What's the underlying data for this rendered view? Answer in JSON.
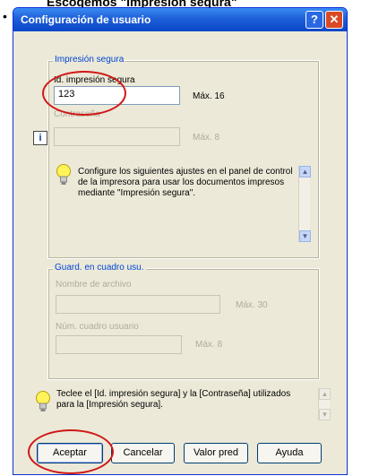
{
  "page": {
    "heading": "Escogemos \"Impresión segura\""
  },
  "window": {
    "title": "Configuración de usuario",
    "help_glyph": "?",
    "close_glyph": "✕"
  },
  "secure_print": {
    "group_label": "Impresión segura",
    "id_label": "Id. impresión segura",
    "id_value": "123",
    "id_max": "Máx. 16",
    "password_label": "Contraseña",
    "password_value": "",
    "password_max": "Máx. 8",
    "info_glyph": "i",
    "help_text": "Configure los siguientes ajustes en el panel de control de la impresora para usar los documentos impresos mediante \"Impresión segura\"."
  },
  "user_box": {
    "group_label": "Guard. en cuadro usu.",
    "file_name_label": "Nombre de archivo",
    "file_name_value": "",
    "file_name_max": "Máx. 30",
    "box_number_label": "Núm. cuadro usuario",
    "box_number_value": "",
    "box_number_max": "Máx. 8"
  },
  "hint": {
    "text": "Teclee el [Id. impresión segura] y la [Contraseña] utilizados para la [Impresión segura]."
  },
  "buttons": {
    "ok": "Aceptar",
    "cancel": "Cancelar",
    "default_values": "Valor pred",
    "help": "Ayuda"
  },
  "colors": {
    "title_bar": "#0a46c8",
    "dialog_bg": "#ece9d8",
    "highlight_ring": "#d01818"
  }
}
